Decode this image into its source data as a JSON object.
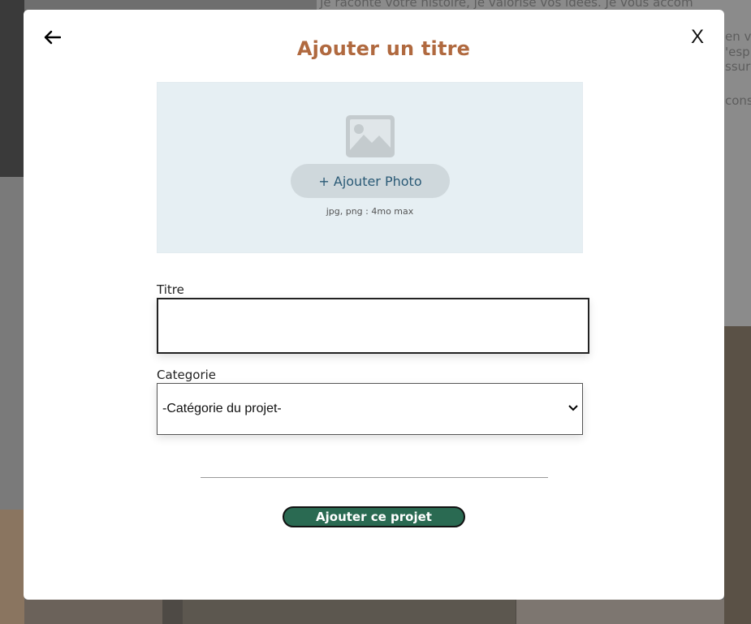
{
  "background": {
    "text_lines": [
      "Je raconte votre histoire, je valorise vos idées. Je vous accom",
      "en v",
      "'esp",
      "ssur",
      "cons"
    ]
  },
  "modal": {
    "title": "Ajouter un titre",
    "back_icon": "arrow-left-icon",
    "close_label": "X",
    "upload": {
      "icon": "image-icon",
      "button_label": "+ Ajouter Photo",
      "hint": "jpg, png : 4mo max"
    },
    "fields": {
      "title_label": "Titre",
      "title_value": "",
      "category_label": "Categorie",
      "category_selected": "-Catégorie du projet-"
    },
    "submit_label": "Ajouter ce projet"
  },
  "colors": {
    "title": "#b0693f",
    "submit_button": "#2a6a52",
    "upload_zone": "#e6eff3",
    "add_photo_button": "#cfd8dc",
    "add_photo_text": "#2a5a76"
  }
}
